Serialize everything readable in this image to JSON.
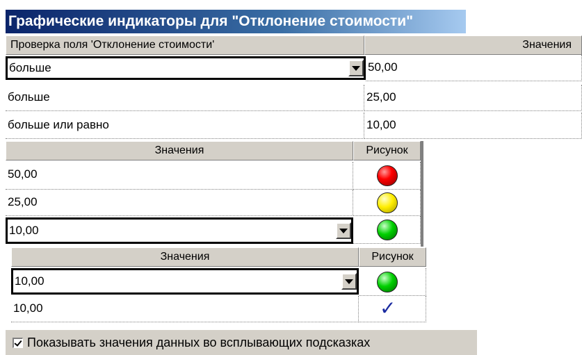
{
  "window": {
    "title": "Графические индикаторы для \"Отклонение стоимости\""
  },
  "grid1": {
    "col_field": "Проверка поля 'Отклонение стоимости'",
    "col_values": "Значения",
    "rows": [
      {
        "op": "больше",
        "value": "50,00"
      },
      {
        "op": "больше",
        "value": "25,00"
      },
      {
        "op": "больше или равно",
        "value": "10,00"
      }
    ]
  },
  "grid2": {
    "col_values": "Значения",
    "col_image": "Рисунок",
    "rows": [
      {
        "value": "50,00",
        "icon": "red-ball-icon"
      },
      {
        "value": "25,00",
        "icon": "yellow-ball-icon"
      },
      {
        "value": "10,00",
        "icon": "green-ball-icon"
      }
    ]
  },
  "grid3": {
    "col_values": "Значения",
    "col_image": "Рисунок",
    "rows": [
      {
        "value": "10,00",
        "icon": "green-ball-icon"
      },
      {
        "value": "10,00",
        "icon": "checkmark-icon",
        "glyph": "✓"
      }
    ]
  },
  "footer": {
    "checkbox_checked": true,
    "checkbox_label": "Показывать значения данных во всплывающих подсказках"
  },
  "colors": {
    "title_bar_start": "#0a246a",
    "title_bar_end": "#a6caf0",
    "dialog_face": "#d4d0c8",
    "checkmark": "#1a2aa0"
  }
}
